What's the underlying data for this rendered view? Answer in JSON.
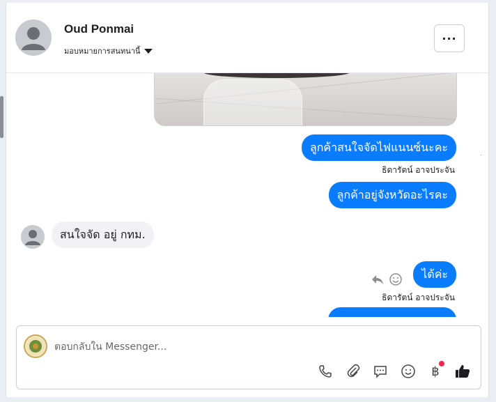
{
  "header": {
    "contact_name": "Oud Ponmai",
    "assign_label": "มอบหมายการสนทนานี้",
    "more_label": "···"
  },
  "messages": [
    {
      "type": "outgoing",
      "text": "ลูกค้าสนใจจัดไฟแนนซ์นะคะ",
      "sender": "ธิดารัตน์ อาจประจัน"
    },
    {
      "type": "outgoing",
      "text": "ลูกค้าอยู่จังหวัดอะไรคะ"
    },
    {
      "type": "incoming",
      "text": "สนใจจัด  อยู่ กทม."
    },
    {
      "type": "outgoing",
      "text": "ได้ค่ะ",
      "sender": "ธิดารัตน์ อาจประจัน"
    }
  ],
  "composer": {
    "placeholder": "ตอบกลับใน Messenger..."
  },
  "icons": {
    "colors": {
      "accent": "#0a7cff",
      "incoming_bg": "#f0f2f5",
      "notification": "#f02849"
    }
  }
}
